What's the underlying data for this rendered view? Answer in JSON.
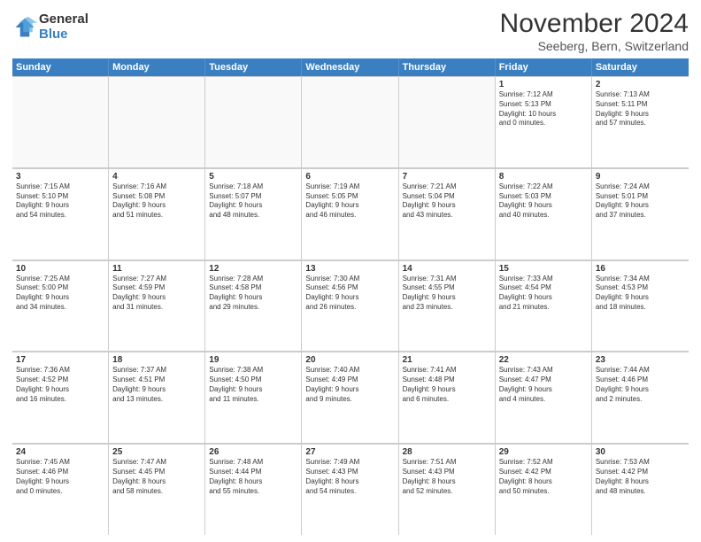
{
  "logo": {
    "general": "General",
    "blue": "Blue"
  },
  "header": {
    "month": "November 2024",
    "location": "Seeberg, Bern, Switzerland"
  },
  "weekdays": [
    "Sunday",
    "Monday",
    "Tuesday",
    "Wednesday",
    "Thursday",
    "Friday",
    "Saturday"
  ],
  "weeks": [
    [
      {
        "day": "",
        "info": "",
        "empty": true
      },
      {
        "day": "",
        "info": "",
        "empty": true
      },
      {
        "day": "",
        "info": "",
        "empty": true
      },
      {
        "day": "",
        "info": "",
        "empty": true
      },
      {
        "day": "",
        "info": "",
        "empty": true
      },
      {
        "day": "1",
        "info": "Sunrise: 7:12 AM\nSunset: 5:13 PM\nDaylight: 10 hours\nand 0 minutes.",
        "empty": false
      },
      {
        "day": "2",
        "info": "Sunrise: 7:13 AM\nSunset: 5:11 PM\nDaylight: 9 hours\nand 57 minutes.",
        "empty": false
      }
    ],
    [
      {
        "day": "3",
        "info": "Sunrise: 7:15 AM\nSunset: 5:10 PM\nDaylight: 9 hours\nand 54 minutes.",
        "empty": false
      },
      {
        "day": "4",
        "info": "Sunrise: 7:16 AM\nSunset: 5:08 PM\nDaylight: 9 hours\nand 51 minutes.",
        "empty": false
      },
      {
        "day": "5",
        "info": "Sunrise: 7:18 AM\nSunset: 5:07 PM\nDaylight: 9 hours\nand 48 minutes.",
        "empty": false
      },
      {
        "day": "6",
        "info": "Sunrise: 7:19 AM\nSunset: 5:05 PM\nDaylight: 9 hours\nand 46 minutes.",
        "empty": false
      },
      {
        "day": "7",
        "info": "Sunrise: 7:21 AM\nSunset: 5:04 PM\nDaylight: 9 hours\nand 43 minutes.",
        "empty": false
      },
      {
        "day": "8",
        "info": "Sunrise: 7:22 AM\nSunset: 5:03 PM\nDaylight: 9 hours\nand 40 minutes.",
        "empty": false
      },
      {
        "day": "9",
        "info": "Sunrise: 7:24 AM\nSunset: 5:01 PM\nDaylight: 9 hours\nand 37 minutes.",
        "empty": false
      }
    ],
    [
      {
        "day": "10",
        "info": "Sunrise: 7:25 AM\nSunset: 5:00 PM\nDaylight: 9 hours\nand 34 minutes.",
        "empty": false
      },
      {
        "day": "11",
        "info": "Sunrise: 7:27 AM\nSunset: 4:59 PM\nDaylight: 9 hours\nand 31 minutes.",
        "empty": false
      },
      {
        "day": "12",
        "info": "Sunrise: 7:28 AM\nSunset: 4:58 PM\nDaylight: 9 hours\nand 29 minutes.",
        "empty": false
      },
      {
        "day": "13",
        "info": "Sunrise: 7:30 AM\nSunset: 4:56 PM\nDaylight: 9 hours\nand 26 minutes.",
        "empty": false
      },
      {
        "day": "14",
        "info": "Sunrise: 7:31 AM\nSunset: 4:55 PM\nDaylight: 9 hours\nand 23 minutes.",
        "empty": false
      },
      {
        "day": "15",
        "info": "Sunrise: 7:33 AM\nSunset: 4:54 PM\nDaylight: 9 hours\nand 21 minutes.",
        "empty": false
      },
      {
        "day": "16",
        "info": "Sunrise: 7:34 AM\nSunset: 4:53 PM\nDaylight: 9 hours\nand 18 minutes.",
        "empty": false
      }
    ],
    [
      {
        "day": "17",
        "info": "Sunrise: 7:36 AM\nSunset: 4:52 PM\nDaylight: 9 hours\nand 16 minutes.",
        "empty": false
      },
      {
        "day": "18",
        "info": "Sunrise: 7:37 AM\nSunset: 4:51 PM\nDaylight: 9 hours\nand 13 minutes.",
        "empty": false
      },
      {
        "day": "19",
        "info": "Sunrise: 7:38 AM\nSunset: 4:50 PM\nDaylight: 9 hours\nand 11 minutes.",
        "empty": false
      },
      {
        "day": "20",
        "info": "Sunrise: 7:40 AM\nSunset: 4:49 PM\nDaylight: 9 hours\nand 9 minutes.",
        "empty": false
      },
      {
        "day": "21",
        "info": "Sunrise: 7:41 AM\nSunset: 4:48 PM\nDaylight: 9 hours\nand 6 minutes.",
        "empty": false
      },
      {
        "day": "22",
        "info": "Sunrise: 7:43 AM\nSunset: 4:47 PM\nDaylight: 9 hours\nand 4 minutes.",
        "empty": false
      },
      {
        "day": "23",
        "info": "Sunrise: 7:44 AM\nSunset: 4:46 PM\nDaylight: 9 hours\nand 2 minutes.",
        "empty": false
      }
    ],
    [
      {
        "day": "24",
        "info": "Sunrise: 7:45 AM\nSunset: 4:46 PM\nDaylight: 9 hours\nand 0 minutes.",
        "empty": false
      },
      {
        "day": "25",
        "info": "Sunrise: 7:47 AM\nSunset: 4:45 PM\nDaylight: 8 hours\nand 58 minutes.",
        "empty": false
      },
      {
        "day": "26",
        "info": "Sunrise: 7:48 AM\nSunset: 4:44 PM\nDaylight: 8 hours\nand 55 minutes.",
        "empty": false
      },
      {
        "day": "27",
        "info": "Sunrise: 7:49 AM\nSunset: 4:43 PM\nDaylight: 8 hours\nand 54 minutes.",
        "empty": false
      },
      {
        "day": "28",
        "info": "Sunrise: 7:51 AM\nSunset: 4:43 PM\nDaylight: 8 hours\nand 52 minutes.",
        "empty": false
      },
      {
        "day": "29",
        "info": "Sunrise: 7:52 AM\nSunset: 4:42 PM\nDaylight: 8 hours\nand 50 minutes.",
        "empty": false
      },
      {
        "day": "30",
        "info": "Sunrise: 7:53 AM\nSunset: 4:42 PM\nDaylight: 8 hours\nand 48 minutes.",
        "empty": false
      }
    ]
  ]
}
